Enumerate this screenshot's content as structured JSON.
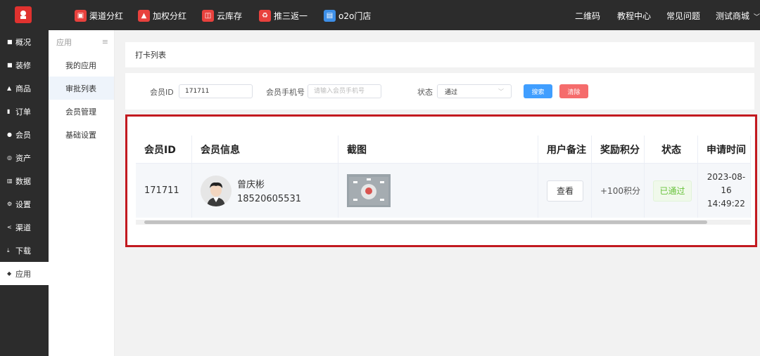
{
  "top_nav": {
    "items": [
      {
        "label": "渠道分红",
        "icon": "channel-dividend-icon",
        "color": "#e8413d"
      },
      {
        "label": "加权分红",
        "icon": "weighted-dividend-icon",
        "color": "#e8413d"
      },
      {
        "label": "云库存",
        "icon": "cloud-stock-icon",
        "color": "#e8413d"
      },
      {
        "label": "推三返一",
        "icon": "refer-three-icon",
        "color": "#e8413d"
      },
      {
        "label": "o2o门店",
        "icon": "store-icon",
        "color": "#3d8fe8"
      }
    ],
    "right": {
      "qrcode": "二维码",
      "tutorial": "教程中心",
      "faq": "常见问题",
      "shop": "测试商城"
    }
  },
  "left_nav": {
    "items": [
      {
        "label": "概况",
        "icon": "overview-icon"
      },
      {
        "label": "装修",
        "icon": "decorate-icon"
      },
      {
        "label": "商品",
        "icon": "goods-icon"
      },
      {
        "label": "订单",
        "icon": "order-icon"
      },
      {
        "label": "会员",
        "icon": "member-icon"
      },
      {
        "label": "资产",
        "icon": "asset-icon"
      },
      {
        "label": "数据",
        "icon": "data-icon"
      },
      {
        "label": "设置",
        "icon": "settings-icon"
      },
      {
        "label": "渠道",
        "icon": "share-icon"
      },
      {
        "label": "下载",
        "icon": "download-icon"
      },
      {
        "label": "应用",
        "icon": "app-icon",
        "active": true
      }
    ]
  },
  "sub_nav": {
    "title": "应用",
    "items": [
      {
        "label": "我的应用"
      },
      {
        "label": "审批列表",
        "active": true
      },
      {
        "label": "会员管理"
      },
      {
        "label": "基础设置"
      }
    ]
  },
  "breadcrumb": "打卡列表",
  "filters": {
    "member_id_label": "会员ID",
    "member_id_value": "171711",
    "phone_label": "会员手机号",
    "phone_placeholder": "请输入会员手机号",
    "status_label": "状态",
    "status_value": "通过",
    "search_button": "搜索",
    "clear_button": "清除"
  },
  "table": {
    "headers": {
      "member_id": "会员ID",
      "member_info": "会员信息",
      "screenshot": "截图",
      "remark": "用户备注",
      "points": "奖励积分",
      "status": "状态",
      "apply_time": "申请时间"
    },
    "rows": [
      {
        "member_id": "171711",
        "name": "曾庆彬",
        "phone": "18520605531",
        "remark_button": "查看",
        "points": "+100积分",
        "status": "已通过",
        "apply_time": "2023-08-16 14:49:22"
      }
    ]
  },
  "colors": {
    "highlight_border": "#c2191f",
    "search": "#409eff",
    "clear": "#f56c6c",
    "status_ok": "#67c23a"
  }
}
